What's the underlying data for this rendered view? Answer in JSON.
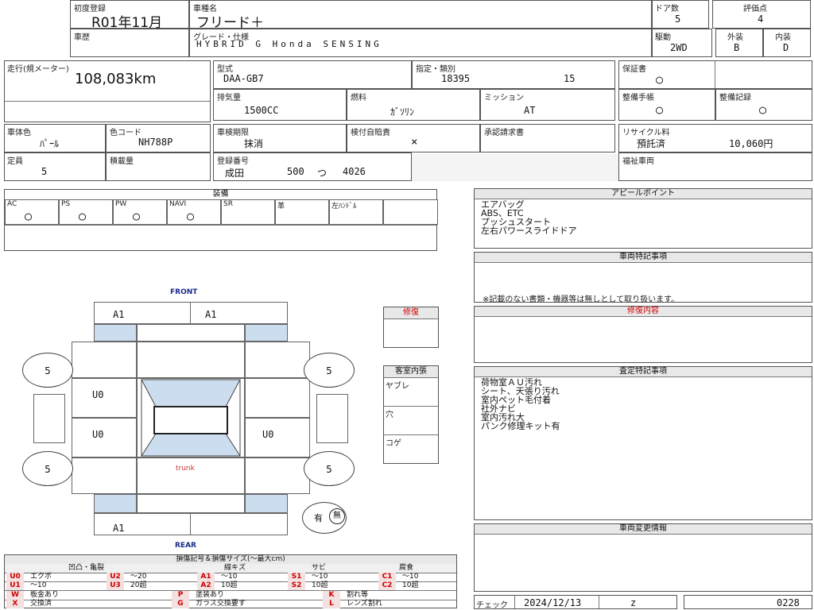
{
  "header": {
    "first_reg_label": "初度登録",
    "first_reg_value": "R01年11月",
    "model_label": "車種名",
    "model_value": "フリード＋",
    "doors_label": "ドア数",
    "doors_value": "5",
    "score_label": "評価点",
    "score_value": "4",
    "history_label": "車歴",
    "grade_label": "グレード・仕様",
    "grade_value": "HYBRID G Honda SENSING",
    "drive_label": "駆動",
    "drive_value": "2WD",
    "exterior_label": "外装",
    "exterior_value": "B",
    "interior_label": "内装",
    "interior_value": "D"
  },
  "specs": {
    "mileage_label": "走行(規メーター)",
    "mileage_value": "108,083km",
    "type_label": "型式",
    "type_value": "DAA-GB7",
    "designation_label": "指定・類別",
    "designation_value_1": "18395",
    "designation_value_2": "15",
    "warranty_label": "保証書",
    "warranty_value": "○",
    "displacement_label": "排気量",
    "displacement_value": "1500CC",
    "fuel_label": "燃料",
    "fuel_value": "ｶﾞｿﾘﾝ",
    "mission_label": "ミッション",
    "mission_value": "AT",
    "maint_manual_label": "整備手帳",
    "maint_manual_value": "○",
    "maint_record_label": "整備記録",
    "maint_record_value": "○",
    "body_color_label": "車体色",
    "body_color_value": "ﾊﾟｰﾙ",
    "color_code_label": "色コード",
    "color_code_value": "NH788P",
    "inspection_label": "車検期限",
    "inspection_value": "抹消",
    "insurance_label": "検付自賠責",
    "insurance_value": "×",
    "approval_label": "承認請求書",
    "recycle_label": "リサイクル料",
    "recycle_status": "預託済",
    "recycle_amount": "10,060円",
    "capacity_label": "定員",
    "capacity_value": "5",
    "load_label": "積載量",
    "plate_label": "登録番号",
    "plate_area": "成田",
    "plate_class": "500",
    "plate_kana": "つ",
    "plate_num": "4026",
    "welfare_label": "福祉車両"
  },
  "equipment": {
    "title": "装備",
    "items": [
      {
        "label": "AC",
        "value": "○"
      },
      {
        "label": "PS",
        "value": "○"
      },
      {
        "label": "PW",
        "value": "○"
      },
      {
        "label": "NAVI",
        "value": "○"
      },
      {
        "label": "SR",
        "value": ""
      },
      {
        "label": "革",
        "value": ""
      },
      {
        "label": "左ﾊﾝﾄﾞﾙ",
        "value": ""
      }
    ]
  },
  "diagram": {
    "front_label": "FRONT",
    "rear_label": "REAR",
    "trunk_label": "trunk",
    "a1_front_left": "A1",
    "a1_front_right": "A1",
    "a1_rear": "A1",
    "tire_fl": "5",
    "tire_fr": "5",
    "tire_rl": "5",
    "tire_rr": "5",
    "u0_left_top": "U0",
    "u0_left_bottom": "U0",
    "u0_right": "U0",
    "yes_label": "有",
    "seal_label": "無"
  },
  "repair_box": {
    "title": "修復"
  },
  "interior_box": {
    "title": "客室内張",
    "rows": [
      "ヤブレ",
      "穴",
      "コゲ"
    ]
  },
  "appeal": {
    "title": "アピールポイント",
    "lines": [
      "エアバッグ",
      "ABS、ETC",
      "プッシュスタート",
      "左右パワースライドドア"
    ]
  },
  "notes": {
    "title": "車両特記事項",
    "note": "※記載のない書類・機器等は無しとして取り扱います。"
  },
  "repair_content": {
    "title": "修復内容"
  },
  "inspection_notes": {
    "title": "査定特記事項",
    "lines": [
      "荷物室ＡＵ汚れ",
      "シート、天張り汚れ",
      "室内ペット毛付着",
      "社外ナビ",
      "室内汚れ大",
      "パンク修理キット有"
    ]
  },
  "change_info": {
    "title": "車両変更情報"
  },
  "footer": {
    "check_label": "チェック",
    "date": "2024/12/13",
    "z": "z",
    "number": "0228"
  },
  "legend": {
    "title": "損傷記号＆損傷サイズ(〜最大cm)",
    "cat1": "凹凸・亀裂",
    "cat2": "線キズ",
    "cat3": "サビ",
    "cat4": "腐食",
    "r1": [
      {
        "code": "U0",
        "desc": "エクボ"
      },
      {
        "code": "U2",
        "desc": "〜20"
      },
      {
        "code": "A1",
        "desc": "〜10"
      },
      {
        "code": "S1",
        "desc": "〜10"
      },
      {
        "code": "C1",
        "desc": "〜10"
      }
    ],
    "r2": [
      {
        "code": "U1",
        "desc": "〜10"
      },
      {
        "code": "U3",
        "desc": "20超"
      },
      {
        "code": "A2",
        "desc": "10超"
      },
      {
        "code": "S2",
        "desc": "10超"
      },
      {
        "code": "C2",
        "desc": "10超"
      }
    ],
    "r3": [
      {
        "code": "W",
        "desc": "板金あり"
      },
      {
        "code": "P",
        "desc": "塗装あり"
      },
      {
        "code": "K",
        "desc": "割れ等"
      }
    ],
    "r4": [
      {
        "code": "X",
        "desc": "交換済"
      },
      {
        "code": "G",
        "desc": "ガラス交換要す"
      },
      {
        "code": "L",
        "desc": "レンズ割れ"
      }
    ]
  }
}
